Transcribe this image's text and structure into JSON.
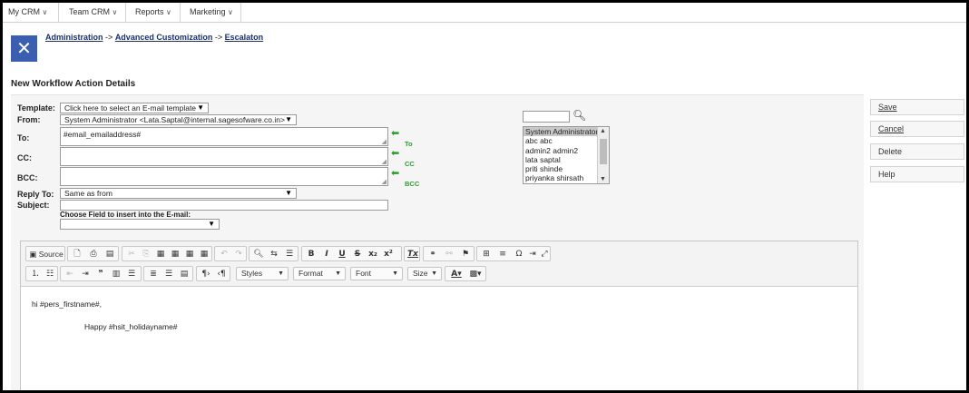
{
  "nav": [
    {
      "label": "My CRM"
    },
    {
      "label": "Team CRM"
    },
    {
      "label": "Reports"
    },
    {
      "label": "Marketing"
    }
  ],
  "breadcrumb": {
    "items": [
      "Administration",
      "Advanced Customization",
      "Escalaton"
    ],
    "sep": "->"
  },
  "page_title": "New Workflow Action Details",
  "form": {
    "template_label": "Template:",
    "template_value": "Click here to select an E-mail template",
    "from_label": "From:",
    "from_value": "System Administrator <Lata.Saptal@internal.sagesofware.co.in>",
    "to_label": "To:",
    "to_value": "#email_emailaddress#",
    "cc_label": "CC:",
    "bcc_label": "BCC:",
    "replyto_label": "Reply To:",
    "replyto_value": "Same as from",
    "subject_label": "Subject:",
    "choose_field_label": "Choose Field to insert into the E-mail:",
    "to_tag": "To",
    "cc_tag": "CC",
    "bcc_tag": "BCC"
  },
  "users": [
    "System Administrator",
    "abc abc",
    "admin2 admin2",
    "lata saptal",
    "priti shinde",
    "priyanka shirsath"
  ],
  "toolbar": {
    "source": "Source",
    "styles": "Styles",
    "format": "Format",
    "font": "Font",
    "size": "Size"
  },
  "editor": {
    "line1": "hi #pers_firstname#,",
    "line2": "Happy  #hsit_holidayname#"
  },
  "actions": {
    "save": "Save",
    "cancel": "Cancel",
    "delete": "Delete",
    "help": "Help"
  },
  "colors": {
    "logo_bg": "#3a5fb0",
    "link": "#1b2f6b",
    "add_arrow": "#2e9b2e"
  }
}
